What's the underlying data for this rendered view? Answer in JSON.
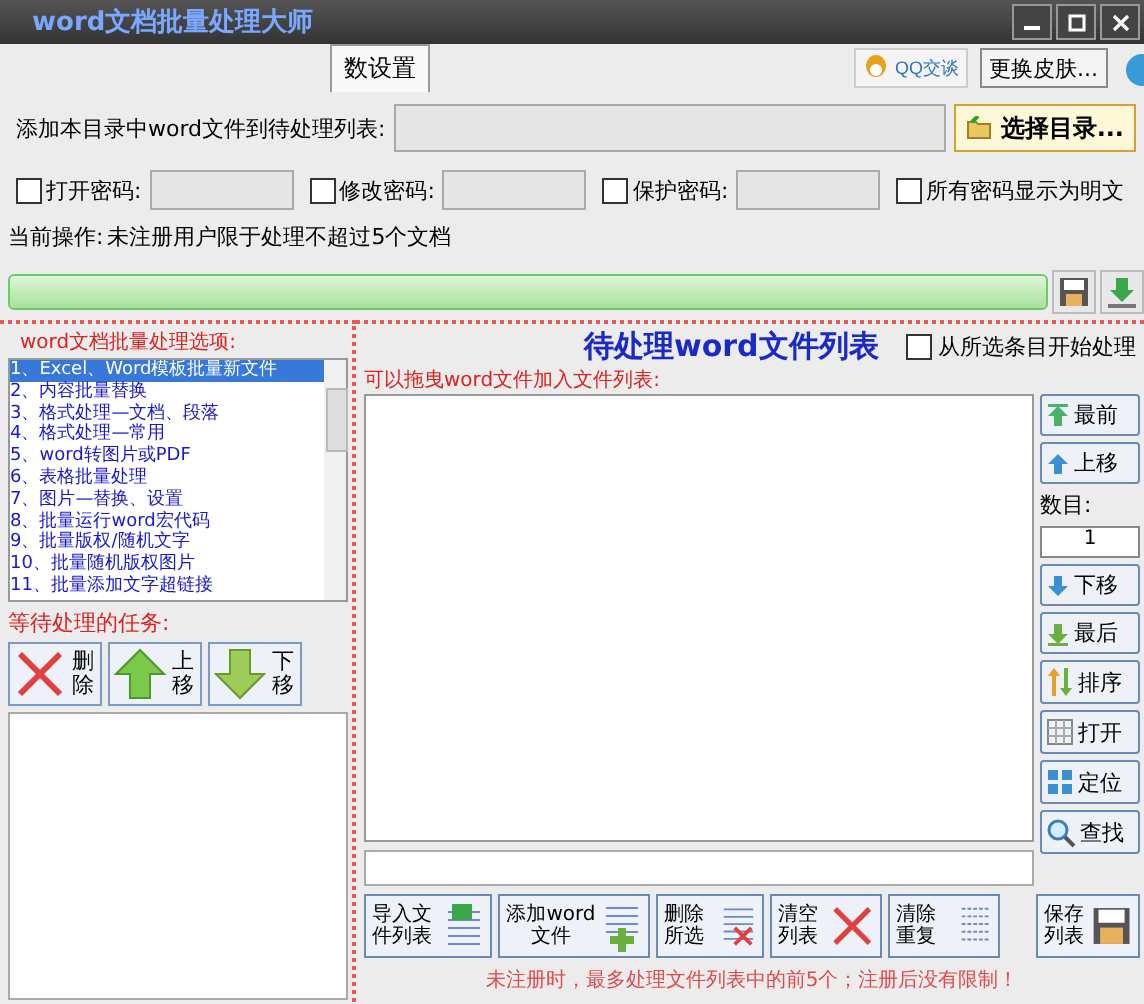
{
  "window": {
    "title": "word文档批量处理大师"
  },
  "tabs": [
    {
      "label": "数设置",
      "selected": true
    }
  ],
  "header_buttons": [
    {
      "label": "QQ交谈",
      "kind": "qq"
    },
    {
      "label": "更换皮肤...",
      "kind": "plain"
    }
  ],
  "folder_row": {
    "label": "添加本目录中word文件到待处理列表:",
    "button": "选择目录..."
  },
  "password_options": [
    {
      "label": "打开密码:",
      "checked": false,
      "kind": "field"
    },
    {
      "label": "修改密码:",
      "checked": false,
      "kind": "field"
    },
    {
      "label": "保护密码:",
      "checked": false,
      "kind": "field"
    },
    {
      "label": "所有密码显示为明文",
      "checked": false,
      "kind": "plain"
    }
  ],
  "current_operation": {
    "label": "当前操作:",
    "text": "未注册用户限于处理不超过5个文档"
  },
  "progress": {
    "level": 1
  },
  "options_panel": {
    "title": "word文档批量处理选项:",
    "items": [
      {
        "label": "1、Excel、Word模板批量新文件",
        "selected": true
      },
      {
        "label": "2、内容批量替换",
        "selected": false
      },
      {
        "label": "3、格式处理—文档、段落",
        "selected": false
      },
      {
        "label": "4、格式处理—常用",
        "selected": false
      },
      {
        "label": "5、word转图片或PDF",
        "selected": false
      },
      {
        "label": "6、表格批量处理",
        "selected": false
      },
      {
        "label": "7、图片—替换、设置",
        "selected": false
      },
      {
        "label": "8、批量运行word宏代码",
        "selected": false
      },
      {
        "label": "9、批量版权/随机文字",
        "selected": false
      },
      {
        "label": "10、批量随机版权图片",
        "selected": false
      },
      {
        "label": "11、批量添加文字超链接",
        "selected": false
      }
    ]
  },
  "tasks_panel": {
    "title": "等待处理的任务:",
    "buttons": [
      {
        "label": "删除",
        "kind": "delete"
      },
      {
        "label": "上移",
        "kind": "up"
      },
      {
        "label": "下移",
        "kind": "down"
      }
    ]
  },
  "file_list": {
    "title": "待处理word文件列表",
    "start_from_selected": {
      "label": "从所选条目开始处理",
      "checked": false
    },
    "hint": "可以拖曳word文件加入文件列表:"
  },
  "side_items": [
    {
      "label": "最前",
      "kind": "top"
    },
    {
      "label": "上移",
      "kind": "up"
    },
    {
      "label": "数目:",
      "kind": "count",
      "value": "1"
    },
    {
      "label": "下移",
      "kind": "down"
    },
    {
      "label": "最后",
      "kind": "bottom"
    },
    {
      "label": "排序",
      "kind": "sort"
    },
    {
      "label": "打开",
      "kind": "open"
    },
    {
      "label": "定位",
      "kind": "locate"
    },
    {
      "label": "查找",
      "kind": "search"
    }
  ],
  "bottom_buttons": [
    {
      "label": "导入文件列表",
      "kind": "import"
    },
    {
      "label": "添加word文件",
      "kind": "add"
    },
    {
      "label": "删除所选",
      "kind": "remove"
    },
    {
      "label": "清空列表",
      "kind": "clear"
    },
    {
      "label": "清除重复",
      "kind": "dedupe"
    },
    {
      "label": "保存列表",
      "kind": "save"
    }
  ],
  "notice": "未注册时，最多处理文件列表中的前5个；注册后没有限制！"
}
